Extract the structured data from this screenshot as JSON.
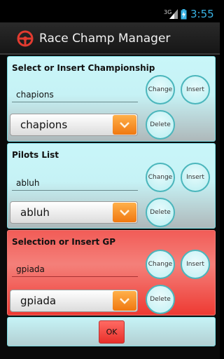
{
  "status_bar": {
    "network": "3G",
    "time": "3:55",
    "colors": {
      "time": "#39b4e6"
    }
  },
  "app": {
    "title": "Race Champ Manager",
    "icon": "steering-wheel-icon"
  },
  "championship": {
    "title": "Select or Insert Championship",
    "input_value": "chapions",
    "selected": "chapions",
    "change_label": "Change",
    "insert_label": "Insert",
    "delete_label": "Delete"
  },
  "pilots": {
    "title": "Pilots List",
    "input_value": "abluh",
    "selected": "abluh",
    "change_label": "Change",
    "insert_label": "Insert",
    "delete_label": "Delete"
  },
  "gp": {
    "title": "Selection or Insert GP",
    "input_value": "gpiada",
    "selected": "gpiada",
    "change_label": "Change",
    "insert_label": "Insert",
    "delete_label": "Delete"
  },
  "footer": {
    "ok_label": "OK"
  }
}
